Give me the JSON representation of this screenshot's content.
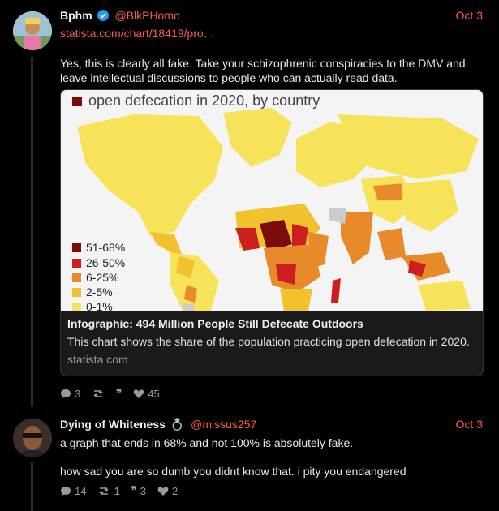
{
  "post1": {
    "display_name": "Bphm",
    "handle": "@BlkPHomo",
    "date": "Oct 3",
    "link": "statista.com/chart/18419/pro…",
    "text": "Yes, this is clearly all fake. Take your schizophrenic conspiracies to the DMV and leave intellectual discussions to people who can actually read data.",
    "card": {
      "image_title": "open defecation in 2020, by country",
      "legend": [
        "51-68%",
        "26-50%",
        "6-25%",
        "2-5%",
        "0-1%"
      ],
      "legend_colors": [
        "#7a0c0c",
        "#cc1f1f",
        "#e8892a",
        "#f2c12e",
        "#f7e35a"
      ],
      "title": "Infographic: 494 Million People Still Defecate Outdoors",
      "description": "This chart shows the share of the population practicing open defecation in 2020.",
      "domain": "statista.com"
    },
    "actions": {
      "replies": "3",
      "reposts": "",
      "quotes": "",
      "likes": "45"
    }
  },
  "post2": {
    "display_name": "Dying of Whiteness",
    "handle": "@missus257",
    "date": "Oct 3",
    "line1": "a graph that ends in 68% and not 100% is absolutely fake.",
    "line2": "how sad you are so dumb you didnt know that. i pity you endangered",
    "actions": {
      "replies": "14",
      "reposts": "1",
      "quotes": "3",
      "likes": "2"
    }
  },
  "colors": {
    "accent": "#ff5a4e",
    "background": "#000000"
  }
}
